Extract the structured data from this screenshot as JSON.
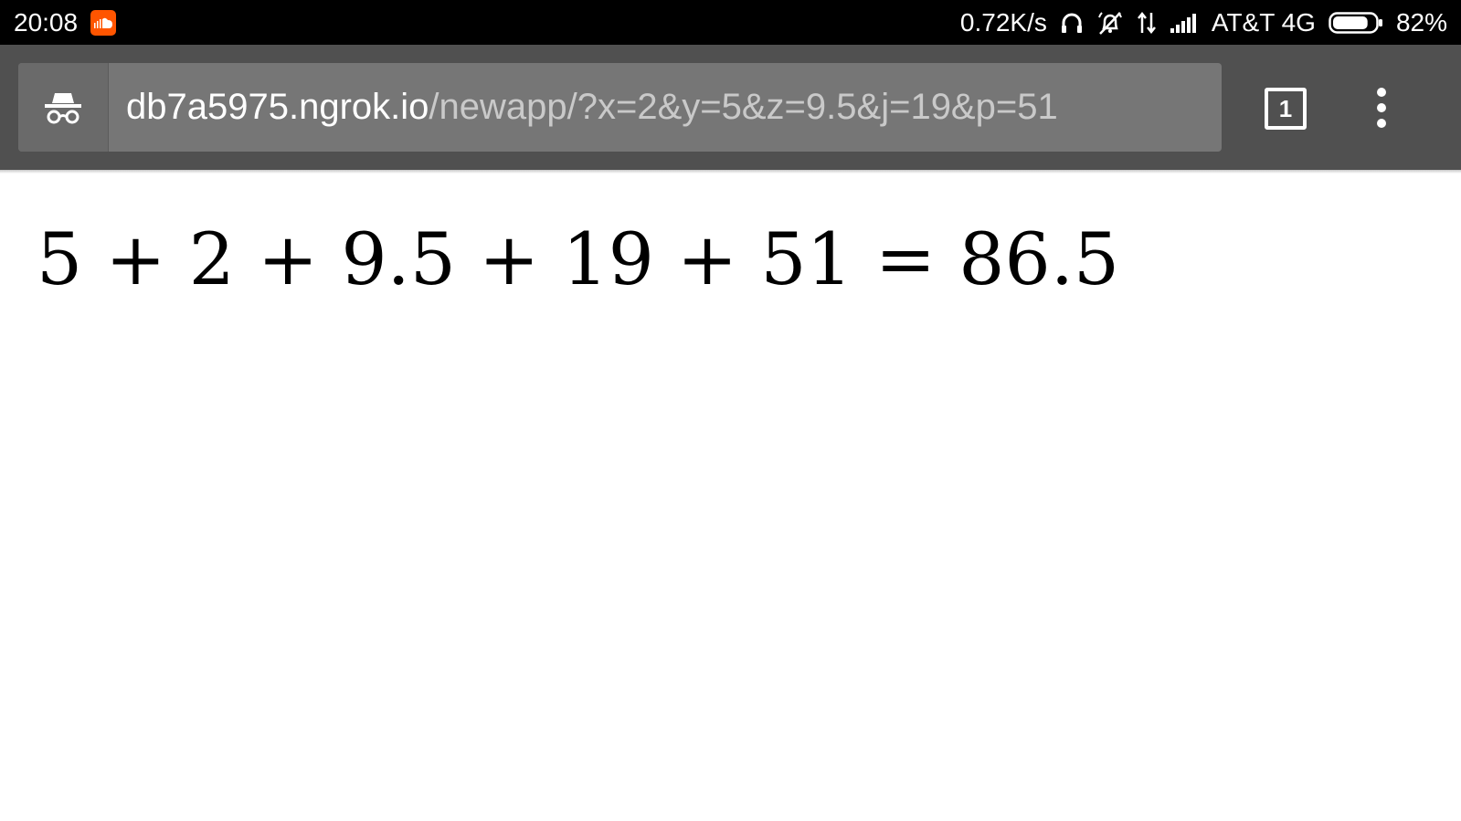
{
  "status_bar": {
    "time": "20:08",
    "app_icon": "soundcloud-icon",
    "network_speed": "0.72K/s",
    "icons": [
      "headphones-icon",
      "alarm-off-icon",
      "data-transfer-icon",
      "signal-bars-icon"
    ],
    "carrier": "AT&T 4G",
    "battery_percent": "82%",
    "battery_level": 0.82
  },
  "browser": {
    "mode_icon": "incognito-icon",
    "url_host": "db7a5975.ngrok.io",
    "url_path": "/newapp/?x=2&y=5&z=9.5&j=19&p=51",
    "tab_count": "1",
    "menu_icon": "more-vert-icon"
  },
  "page": {
    "equation": "5 + 2 + 9.5 + 19 + 51 = 86.5"
  },
  "colors": {
    "status_bar": "#000000",
    "toolbar": "#505050",
    "omnibox": "#767676",
    "soundcloud_orange": "#ff5500"
  }
}
